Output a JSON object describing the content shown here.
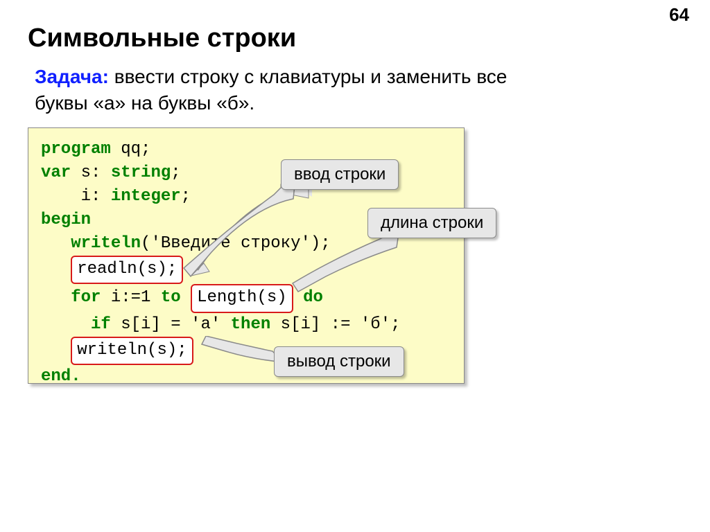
{
  "page_number": "64",
  "title": "Символьные строки",
  "task": {
    "label": "Задача:",
    "text_line1": " ввести строку с клавиатуры и заменить все",
    "text_line2": "буквы «а» на буквы «б»."
  },
  "code": {
    "l1a": "program",
    "l1b": " qq;",
    "l2a": "var",
    "l2b": " s: ",
    "l2c": "string",
    "l2d": ";",
    "l3a": "    i: ",
    "l3b": "integer",
    "l3c": ";",
    "l4": "begin",
    "l5a": "   ",
    "l5b": "writeln",
    "l5c": "('Введите строку');",
    "l6a": "   ",
    "l6hl": "readln(s);",
    "l7a": "   ",
    "l7b": "for",
    "l7c": " i:=1 ",
    "l7d": "to",
    "l7e": " ",
    "l7hl": "Length(s)",
    "l7f": " ",
    "l7g": "do",
    "l8a": "     ",
    "l8b": "if",
    "l8c": " s[i] = 'а' ",
    "l8d": "then",
    "l8e": " s[i] := 'б';",
    "l9a": "   ",
    "l9hl": "writeln(s);",
    "l10": "end."
  },
  "callouts": {
    "c1": "ввод строки",
    "c2": "длина строки",
    "c3": "вывод строки"
  }
}
